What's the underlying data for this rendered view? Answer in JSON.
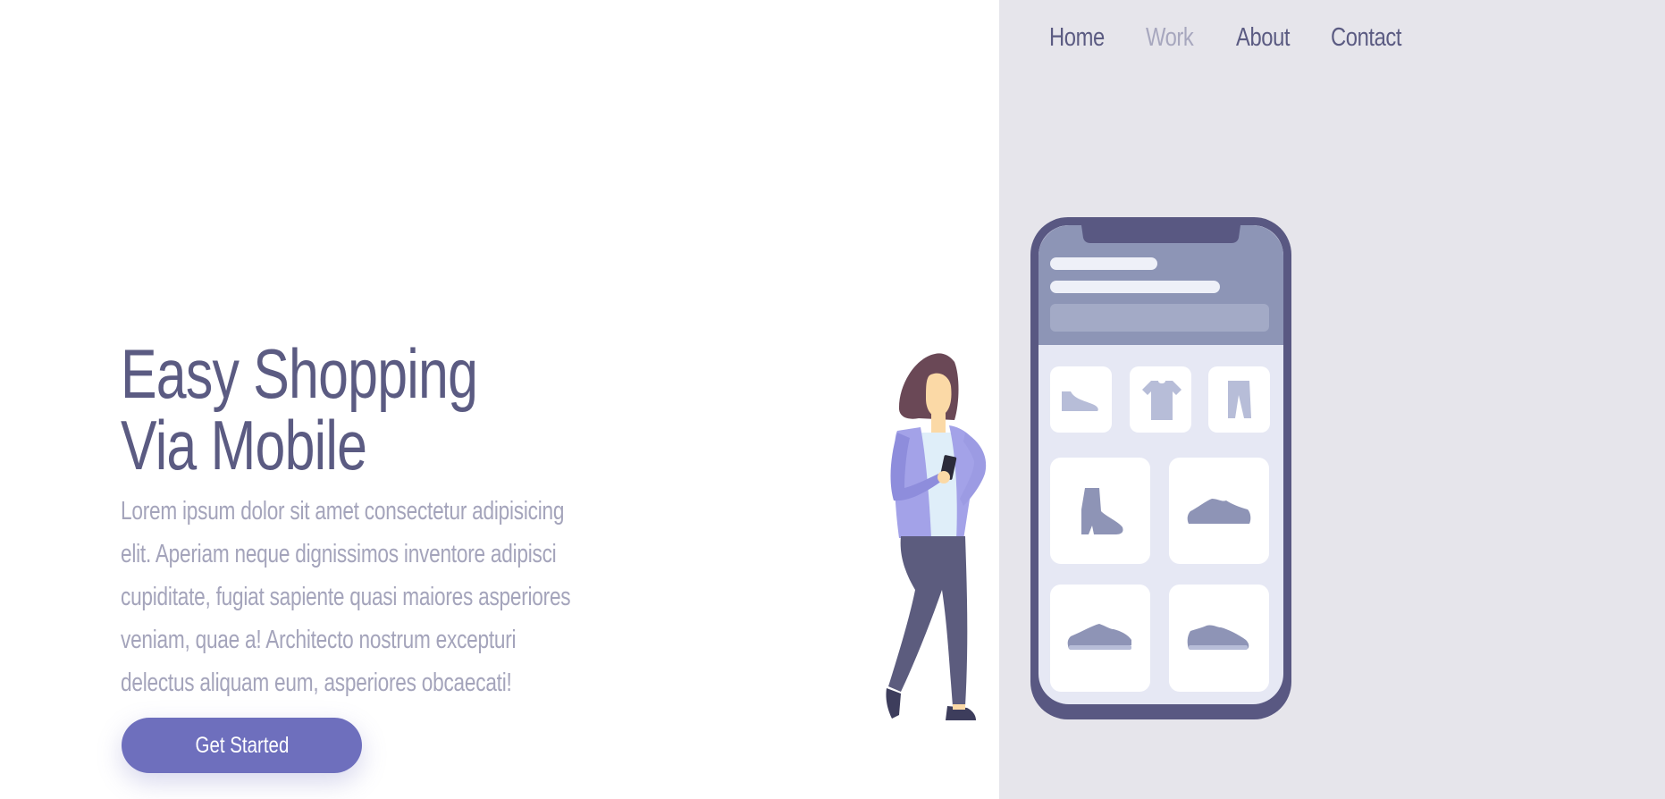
{
  "nav": {
    "items": [
      {
        "label": "Home"
      },
      {
        "label": "Work"
      },
      {
        "label": "About"
      },
      {
        "label": "Contact"
      }
    ]
  },
  "hero": {
    "title_line1": "Easy Shopping",
    "title_line2": "Via Mobile",
    "description": "Lorem ipsum dolor sit amet consectetur adipisicing elit. Aperiam neque dignissimos inventore adipisci cupiditate, fugiat sapiente quasi maiores asperiores veniam, quae a! Architecto nostrum excepturi delectus aliquam eum, asperiores obcaecati!",
    "cta_label": "Get Started"
  },
  "colors": {
    "brand": "#5b5b82",
    "muted_text": "#a4a4bb",
    "accent": "#6e6fbd",
    "panel_bg": "#e6e5eb"
  },
  "illustration": {
    "icons": [
      "shoe-icon",
      "tshirt-icon",
      "pants-icon",
      "boot-icon",
      "sneaker-icon",
      "running-shoe-icon",
      "sneaker-icon"
    ]
  }
}
